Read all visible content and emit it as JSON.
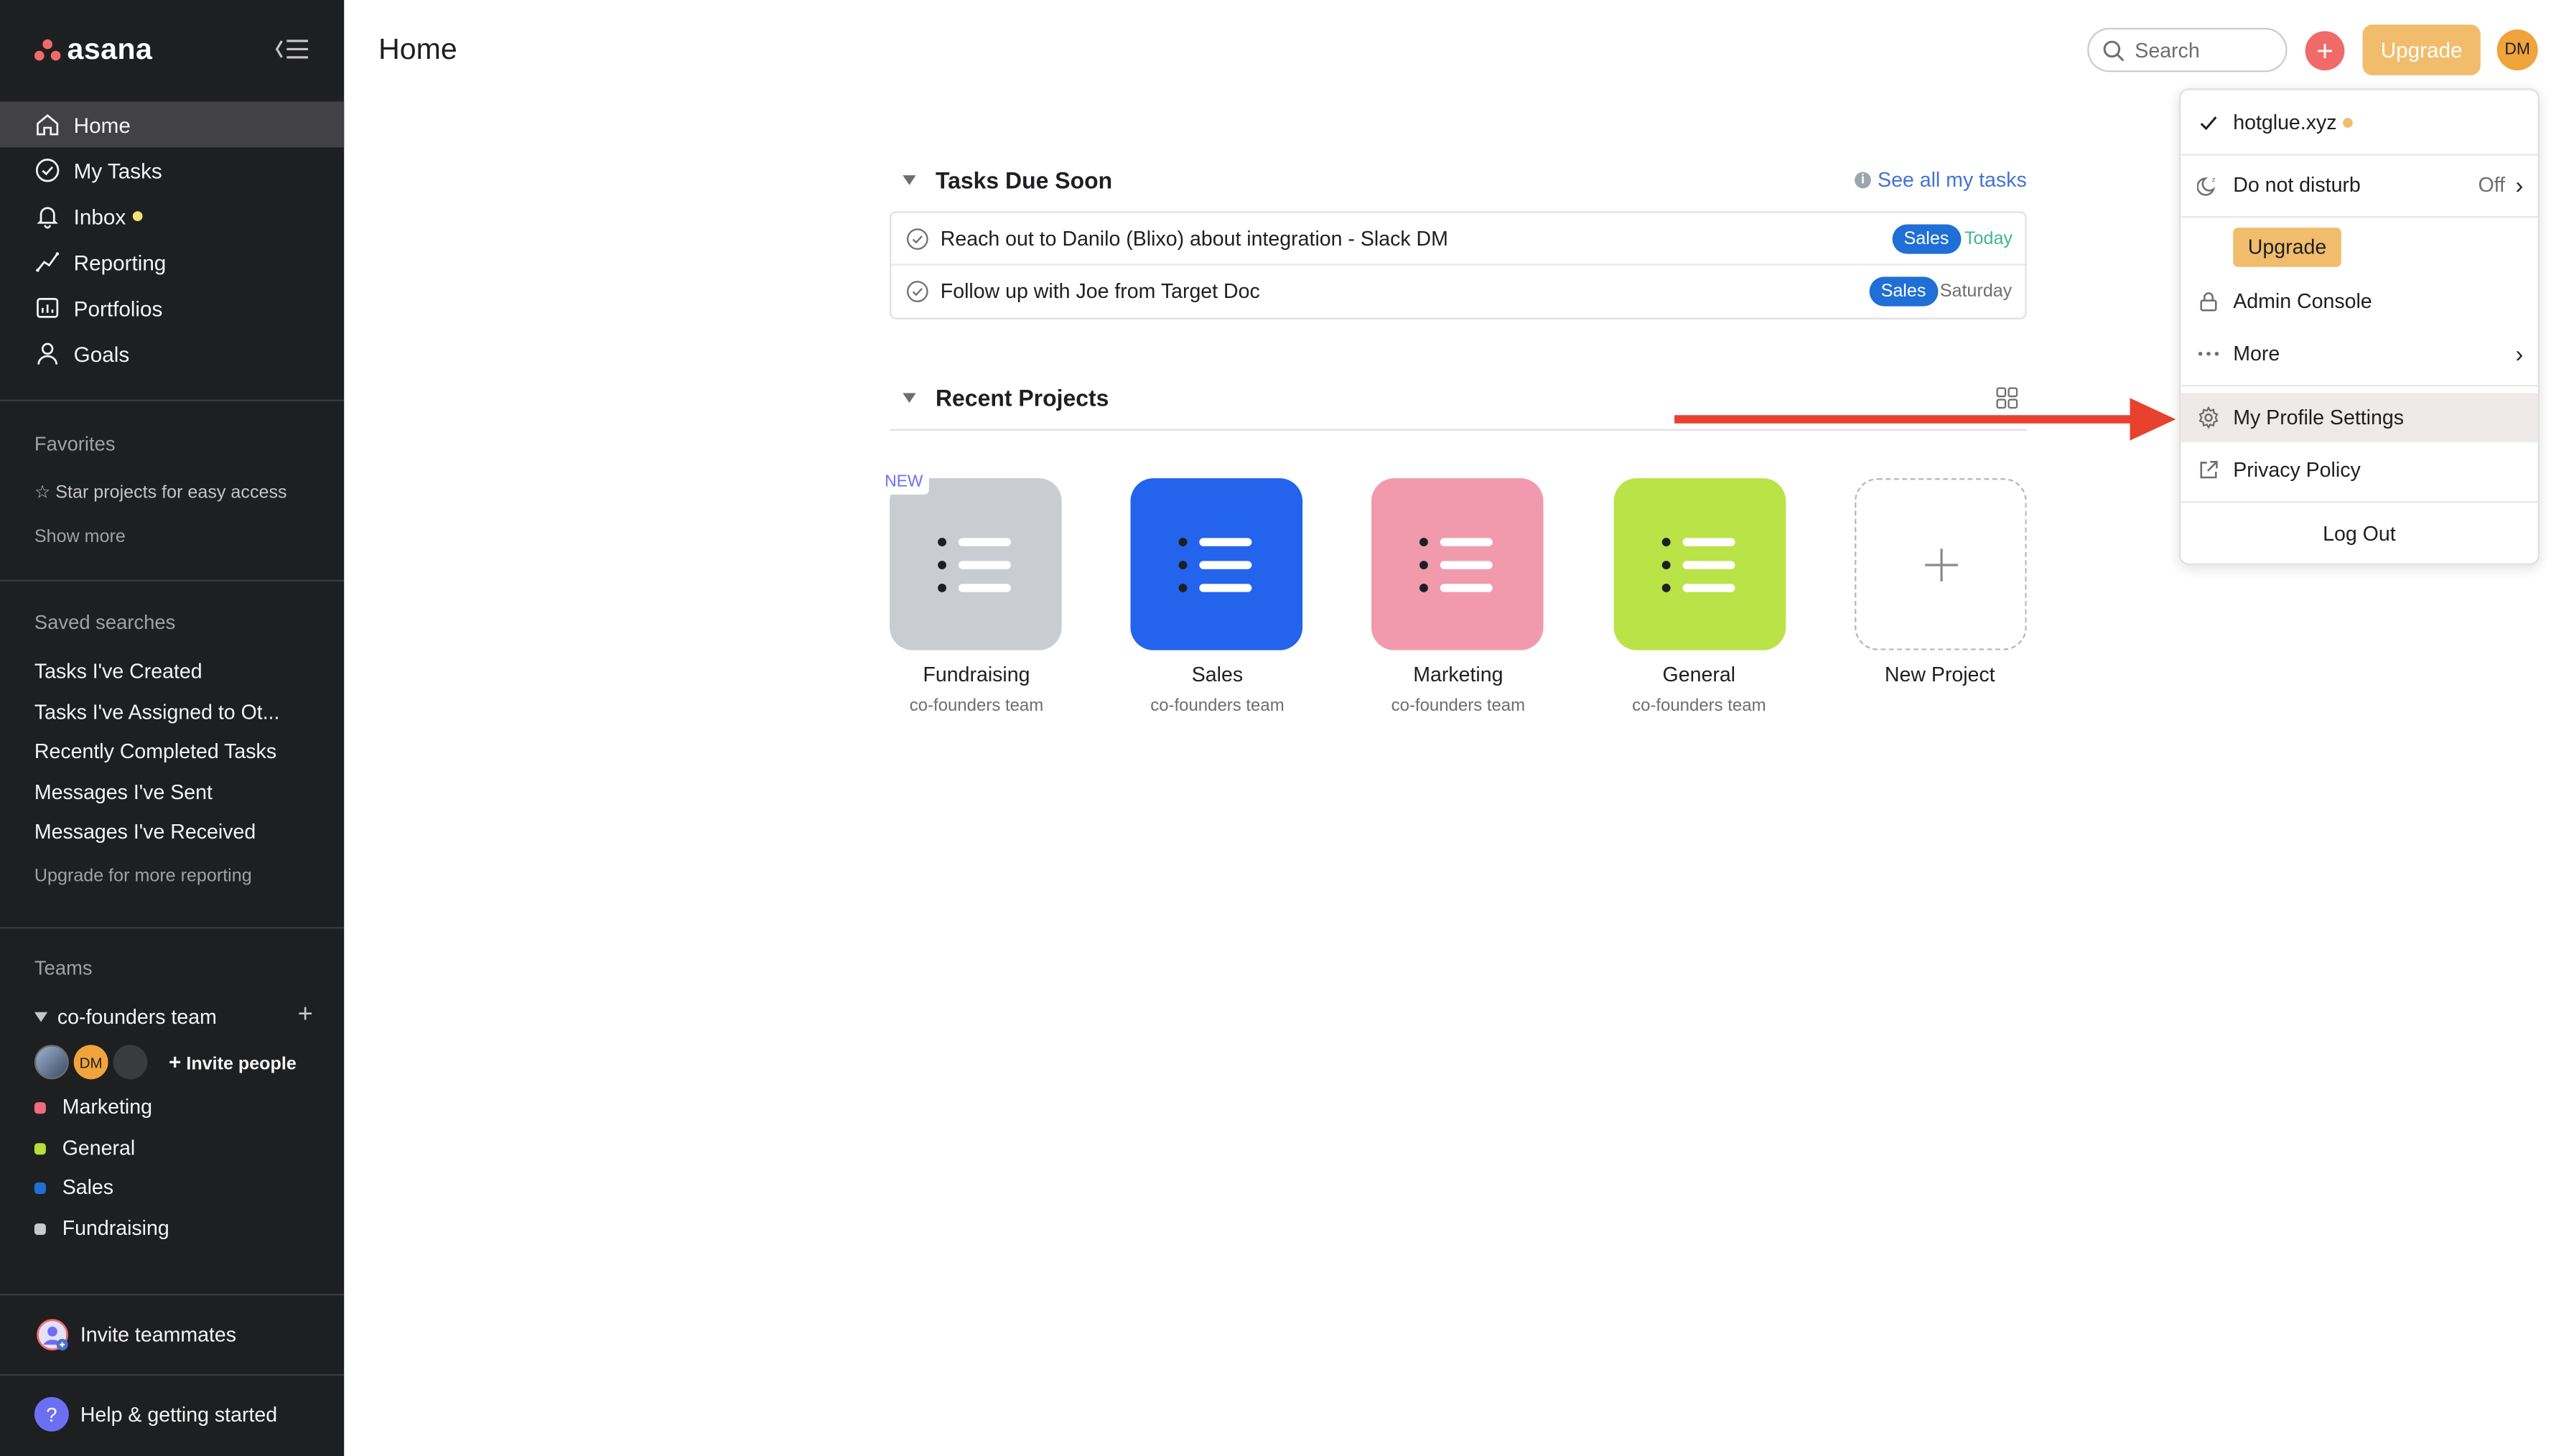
{
  "app": {
    "logo_text": "asana",
    "page_title": "Home"
  },
  "sidebar": {
    "nav": [
      {
        "label": "Home",
        "icon": "home-icon",
        "active": true
      },
      {
        "label": "My Tasks",
        "icon": "check-circle-icon"
      },
      {
        "label": "Inbox",
        "icon": "bell-icon",
        "dot": true
      },
      {
        "label": "Reporting",
        "icon": "reporting-icon"
      },
      {
        "label": "Portfolios",
        "icon": "portfolio-icon"
      },
      {
        "label": "Goals",
        "icon": "goals-icon"
      }
    ],
    "favorites_title": "Favorites",
    "favorites_hint": "Star projects for easy access",
    "show_more": "Show more",
    "saved_searches_title": "Saved searches",
    "saved_searches": [
      "Tasks I've Created",
      "Tasks I've Assigned to Ot...",
      "Recently Completed Tasks",
      "Messages I've Sent",
      "Messages I've Received"
    ],
    "upgrade_reporting": "Upgrade for more reporting",
    "teams_title": "Teams",
    "team_name": "co-founders team",
    "team_avatar_initials": "DM",
    "invite_people": "Invite people",
    "projects": [
      {
        "label": "Marketing",
        "color": "#f06a80"
      },
      {
        "label": "General",
        "color": "#b4e03a"
      },
      {
        "label": "Sales",
        "color": "#1f6fd6"
      },
      {
        "label": "Fundraising",
        "color": "#c7c9cc"
      }
    ],
    "invite_teammates": "Invite teammates",
    "help": "Help & getting started",
    "help_glyph": "?"
  },
  "topbar": {
    "search_placeholder": "Search",
    "plus_glyph": "+",
    "upgrade_label": "Upgrade",
    "avatar_initials": "DM"
  },
  "tasks_due_soon": {
    "title": "Tasks Due Soon",
    "see_all": "See all my tasks",
    "info_glyph": "i",
    "tasks": [
      {
        "name": "Reach out to Danilo (Blixo) about integration - Slack DM",
        "tag": "Sales",
        "due": "Today",
        "due_color": "#3fb68b"
      },
      {
        "name": "Follow up with Joe from Target Doc",
        "tag": "Sales",
        "due": "Saturday",
        "due_color": "#6d6e6f"
      }
    ]
  },
  "recent_projects": {
    "title": "Recent Projects",
    "new_badge": "NEW",
    "projects": [
      {
        "name": "Fundraising",
        "team": "co-founders team",
        "color": "#c9cdd2",
        "dot": "#1e1f21"
      },
      {
        "name": "Sales",
        "team": "co-founders team",
        "color": "#2463eb",
        "dot": "#1e1f21"
      },
      {
        "name": "Marketing",
        "team": "co-founders team",
        "color": "#f19aae",
        "dot": "#1e1f21"
      },
      {
        "name": "General",
        "team": "co-founders team",
        "color": "#b9e346",
        "dot": "#1e1f21"
      }
    ],
    "new_project": "New Project"
  },
  "menu": {
    "workspace": "hotglue.xyz",
    "do_not_disturb": "Do not disturb",
    "dnd_state": "Off",
    "upgrade": "Upgrade",
    "admin_console": "Admin Console",
    "more": "More",
    "profile_settings": "My Profile Settings",
    "privacy_policy": "Privacy Policy",
    "log_out": "Log Out"
  },
  "colors": {
    "sidebar_bg": "#1e1f21",
    "accent_coral": "#f06a6a",
    "upgrade_gold": "#f1bd6c",
    "link_blue": "#4573d2",
    "annotation_arrow": "#e8412e"
  }
}
